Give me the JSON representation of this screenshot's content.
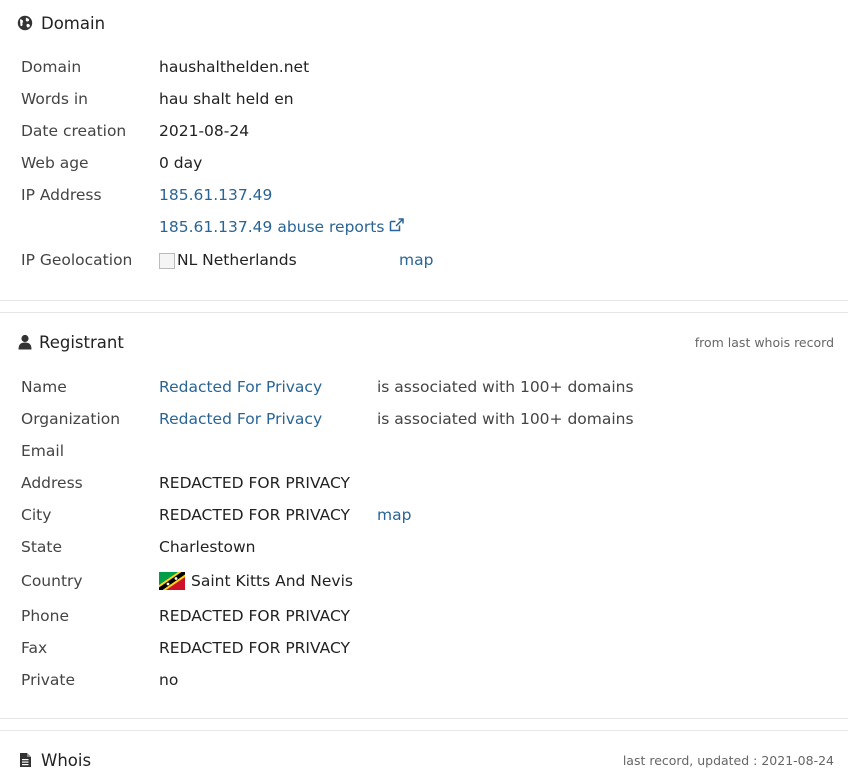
{
  "domain_section": {
    "title": "Domain",
    "rows": {
      "domain": {
        "label": "Domain",
        "value": "haushalthelden.net"
      },
      "words": {
        "label": "Words in",
        "value": "hau shalt held en"
      },
      "date_creation": {
        "label": "Date creation",
        "value": "2021-08-24"
      },
      "web_age": {
        "label": "Web age",
        "value": "0 day"
      },
      "ip": {
        "label": "IP Address",
        "value": "185.61.137.49"
      },
      "abuse": {
        "value": "185.61.137.49 abuse reports"
      },
      "geo": {
        "label": "IP Geolocation",
        "flag_alt": "NL",
        "value": "Netherlands",
        "map_link": "map"
      }
    }
  },
  "registrant_section": {
    "title": "Registrant",
    "note": "from last whois record",
    "rows": {
      "name": {
        "label": "Name",
        "value": "Redacted For Privacy",
        "extra": "is associated with 100+ domains"
      },
      "org": {
        "label": "Organization",
        "value": "Redacted For Privacy",
        "extra": "is associated with 100+ domains"
      },
      "email": {
        "label": "Email",
        "value": ""
      },
      "address": {
        "label": "Address",
        "value": "REDACTED FOR PRIVACY"
      },
      "city": {
        "label": "City",
        "value": "REDACTED FOR PRIVACY",
        "map_link": "map"
      },
      "state": {
        "label": "State",
        "value": "Charlestown"
      },
      "country": {
        "label": "Country",
        "value": "Saint Kitts And Nevis"
      },
      "phone": {
        "label": "Phone",
        "value": "REDACTED FOR PRIVACY"
      },
      "fax": {
        "label": "Fax",
        "value": "REDACTED FOR PRIVACY"
      },
      "private": {
        "label": "Private",
        "value": "no"
      }
    }
  },
  "whois_section": {
    "title": "Whois",
    "note": "last record, updated : 2021-08-24"
  },
  "colors": {
    "link": "#2a6496",
    "divider": "#e6e6e6"
  }
}
